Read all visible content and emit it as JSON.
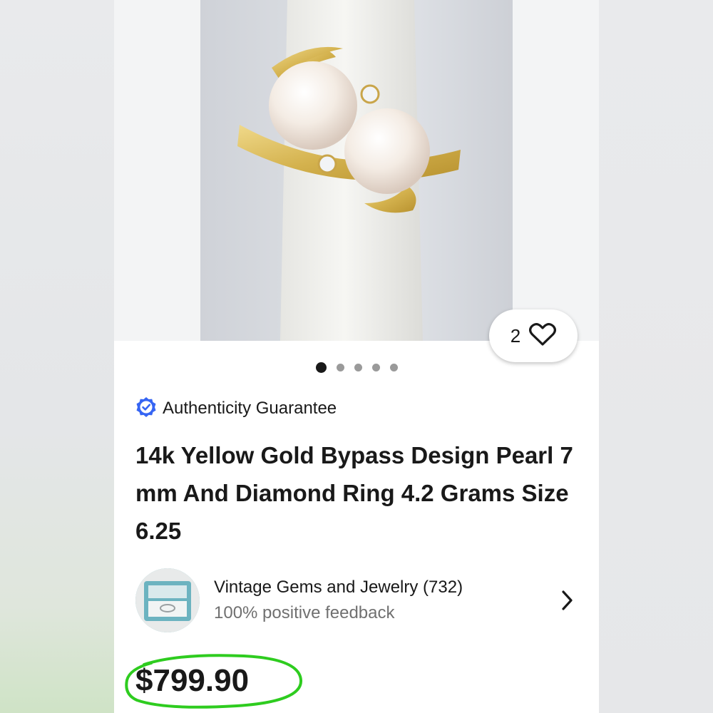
{
  "listing": {
    "watch_count": "2",
    "image_pager": {
      "total": 5,
      "active_index": 0
    },
    "authenticity_label": "Authenticity Guarantee",
    "title": "14k Yellow Gold Bypass Design Pearl 7 mm And Diamond Ring 4.2 Grams Size 6.25",
    "seller": {
      "name": "Vintage Gems and Jewelry (732)",
      "feedback": "100% positive feedback"
    },
    "price": "$799.90"
  },
  "colors": {
    "accent_blue": "#3665f3",
    "annotation_green": "#2ecc1f",
    "text_primary": "#191919",
    "text_secondary": "#707070"
  },
  "icons": {
    "heart": "heart-icon",
    "verified": "verified-check-icon",
    "chevron": "chevron-right-icon"
  }
}
